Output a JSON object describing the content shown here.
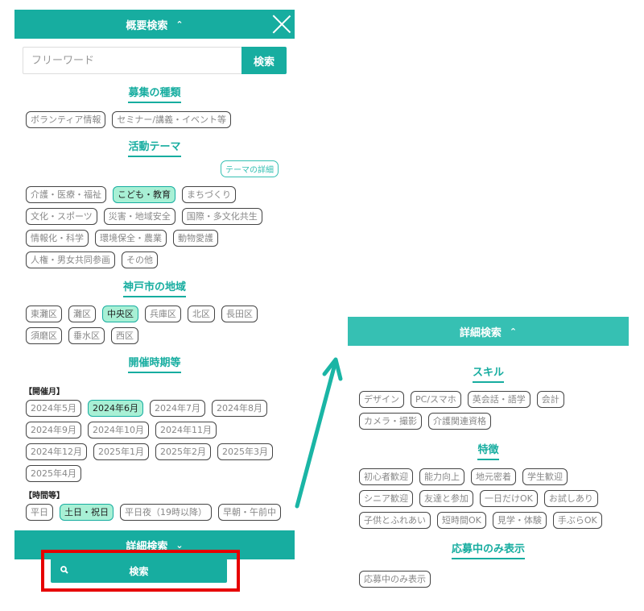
{
  "left": {
    "header": {
      "title": "概要検索",
      "chevron": "chevron-up-icon",
      "close": "close-icon"
    },
    "search": {
      "placeholder": "フリーワード",
      "value": "",
      "button": "検索"
    },
    "recruit_type": {
      "title": "募集の種類",
      "chips": [
        {
          "label": "ボランティア情報",
          "selected": false
        },
        {
          "label": "セミナー/講義・イベント等",
          "selected": false
        }
      ]
    },
    "theme": {
      "title": "活動テーマ",
      "detail_link": "テーマの詳細",
      "chips": [
        {
          "label": "介護・医療・福祉",
          "selected": false
        },
        {
          "label": "こども・教育",
          "selected": true
        },
        {
          "label": "まちづくり",
          "selected": false
        },
        {
          "label": "文化・スポーツ",
          "selected": false
        },
        {
          "label": "災害・地域安全",
          "selected": false
        },
        {
          "label": "国際・多文化共生",
          "selected": false
        },
        {
          "label": "情報化・科学",
          "selected": false
        },
        {
          "label": "環境保全・農業",
          "selected": false
        },
        {
          "label": "動物愛護",
          "selected": false
        },
        {
          "label": "人権・男女共同参画",
          "selected": false
        },
        {
          "label": "その他",
          "selected": false
        }
      ]
    },
    "area": {
      "title": "神戸市の地域",
      "chips": [
        {
          "label": "東灘区",
          "selected": false
        },
        {
          "label": "灘区",
          "selected": false
        },
        {
          "label": "中央区",
          "selected": true
        },
        {
          "label": "兵庫区",
          "selected": false
        },
        {
          "label": "北区",
          "selected": false
        },
        {
          "label": "長田区",
          "selected": false
        },
        {
          "label": "須磨区",
          "selected": false
        },
        {
          "label": "垂水区",
          "selected": false
        },
        {
          "label": "西区",
          "selected": false
        }
      ]
    },
    "period": {
      "title": "開催時期等",
      "month_label": "【開催月】",
      "months": [
        {
          "label": "2024年5月",
          "selected": false
        },
        {
          "label": "2024年6月",
          "selected": true
        },
        {
          "label": "2024年7月",
          "selected": false
        },
        {
          "label": "2024年8月",
          "selected": false
        },
        {
          "label": "2024年9月",
          "selected": false
        },
        {
          "label": "2024年10月",
          "selected": false
        },
        {
          "label": "2024年11月",
          "selected": false
        },
        {
          "label": "2024年12月",
          "selected": false
        },
        {
          "label": "2025年1月",
          "selected": false
        },
        {
          "label": "2025年2月",
          "selected": false
        },
        {
          "label": "2025年3月",
          "selected": false
        },
        {
          "label": "2025年4月",
          "selected": false
        }
      ],
      "time_label": "【時間等】",
      "times": [
        {
          "label": "平日",
          "selected": false
        },
        {
          "label": "土日・祝日",
          "selected": true
        },
        {
          "label": "平日夜（19時以降）",
          "selected": false
        },
        {
          "label": "早朝・午前中",
          "selected": false
        }
      ]
    },
    "detail_bar": {
      "title": "詳細検索",
      "chevron": "chevron-down-icon"
    },
    "submit": {
      "label": "検索",
      "icon": "search-icon"
    }
  },
  "right": {
    "header": {
      "title": "詳細検索",
      "chevron": "chevron-up-icon"
    },
    "skill": {
      "title": "スキル",
      "chips": [
        {
          "label": "デザイン",
          "selected": false
        },
        {
          "label": "PC/スマホ",
          "selected": false
        },
        {
          "label": "英会話・語学",
          "selected": false
        },
        {
          "label": "会計",
          "selected": false
        },
        {
          "label": "カメラ・撮影",
          "selected": false
        },
        {
          "label": "介護関連資格",
          "selected": false
        }
      ]
    },
    "feature": {
      "title": "特徴",
      "chips": [
        {
          "label": "初心者歓迎",
          "selected": false
        },
        {
          "label": "能力向上",
          "selected": false
        },
        {
          "label": "地元密着",
          "selected": false
        },
        {
          "label": "学生歓迎",
          "selected": false
        },
        {
          "label": "シニア歓迎",
          "selected": false
        },
        {
          "label": "友達と参加",
          "selected": false
        },
        {
          "label": "一日だけOK",
          "selected": false
        },
        {
          "label": "お試しあり",
          "selected": false
        },
        {
          "label": "子供とふれあい",
          "selected": false
        },
        {
          "label": "短時間OK",
          "selected": false
        },
        {
          "label": "見学・体験",
          "selected": false
        },
        {
          "label": "手ぶらOK",
          "selected": false
        }
      ]
    },
    "open_only": {
      "title": "応募中のみ表示",
      "chips": [
        {
          "label": "応募中のみ表示",
          "selected": false
        }
      ]
    }
  },
  "colors": {
    "primary": "#17ada0",
    "secondary": "#36c0b3",
    "selected_bg": "#a8f0d5",
    "highlight": "#e60000"
  }
}
